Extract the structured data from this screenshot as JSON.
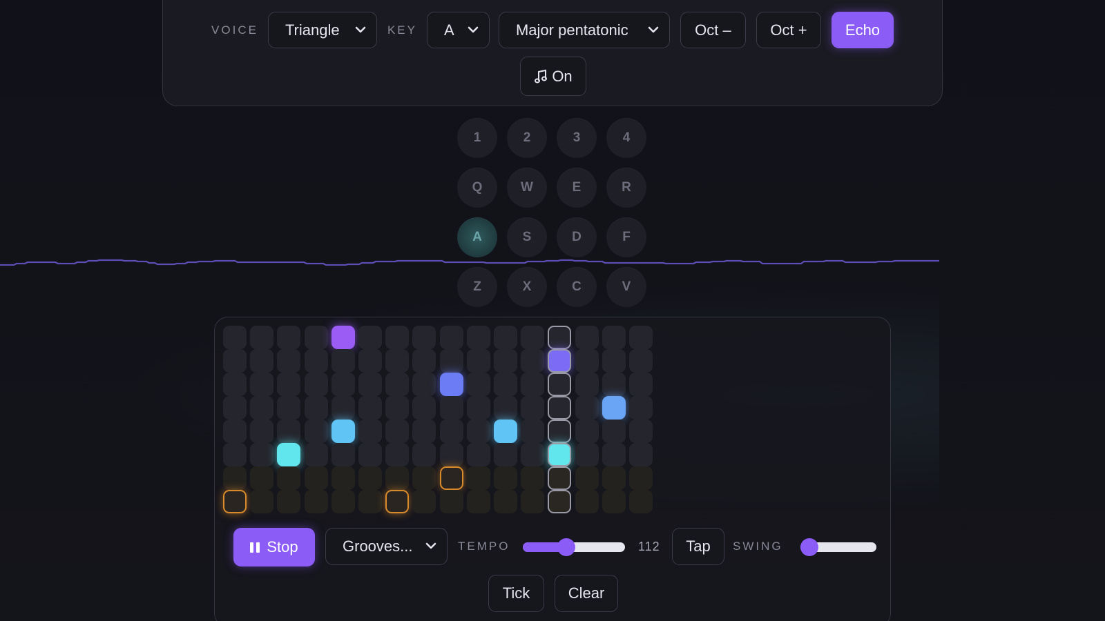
{
  "toolbar": {
    "voice_label": "VOICE",
    "voice_value": "Triangle",
    "key_label": "KEY",
    "key_value": "A",
    "scale_value": "Major pentatonic",
    "oct_down_label": "Oct –",
    "oct_up_label": "Oct +",
    "echo_label": "Echo",
    "sound_toggle_label": "On"
  },
  "keyboard": {
    "rows": [
      [
        "1",
        "2",
        "3",
        "4"
      ],
      [
        "Q",
        "W",
        "E",
        "R"
      ],
      [
        "A",
        "S",
        "D",
        "F"
      ],
      [
        "Z",
        "X",
        "C",
        "V"
      ]
    ],
    "active_key": "A"
  },
  "sequencer": {
    "columns": 16,
    "rows": 8,
    "playhead_step": 13,
    "active_notes": [
      {
        "row": 1,
        "step": 5,
        "color": "#9b5cf6"
      },
      {
        "row": 2,
        "step": 13,
        "color": "#7c6cf5"
      },
      {
        "row": 3,
        "step": 9,
        "color": "#6b7cf5"
      },
      {
        "row": 4,
        "step": 15,
        "color": "#6aa4f5"
      },
      {
        "row": 5,
        "step": 5,
        "color": "#60c4f5"
      },
      {
        "row": 5,
        "step": 11,
        "color": "#60c4f5"
      },
      {
        "row": 6,
        "step": 3,
        "color": "#62e6ee"
      },
      {
        "row": 6,
        "step": 13,
        "color": "#62e6ee"
      },
      {
        "row": 7,
        "step": 9,
        "color": "#d98a2a"
      },
      {
        "row": 8,
        "step": 1,
        "color": "#d98a2a"
      },
      {
        "row": 8,
        "step": 7,
        "color": "#d98a2a"
      }
    ],
    "stop_label": "Stop",
    "pattern_value": "Grooves...",
    "tempo_label": "TEMPO",
    "tempo_value": "112",
    "tempo_fraction": 0.41,
    "tap_label": "Tap",
    "swing_label": "SWING",
    "swing_fraction": 0.0,
    "tick_label": "Tick",
    "clear_label": "Clear"
  },
  "colors": {
    "accent": "#8b5cf6",
    "background": "#11111a"
  }
}
